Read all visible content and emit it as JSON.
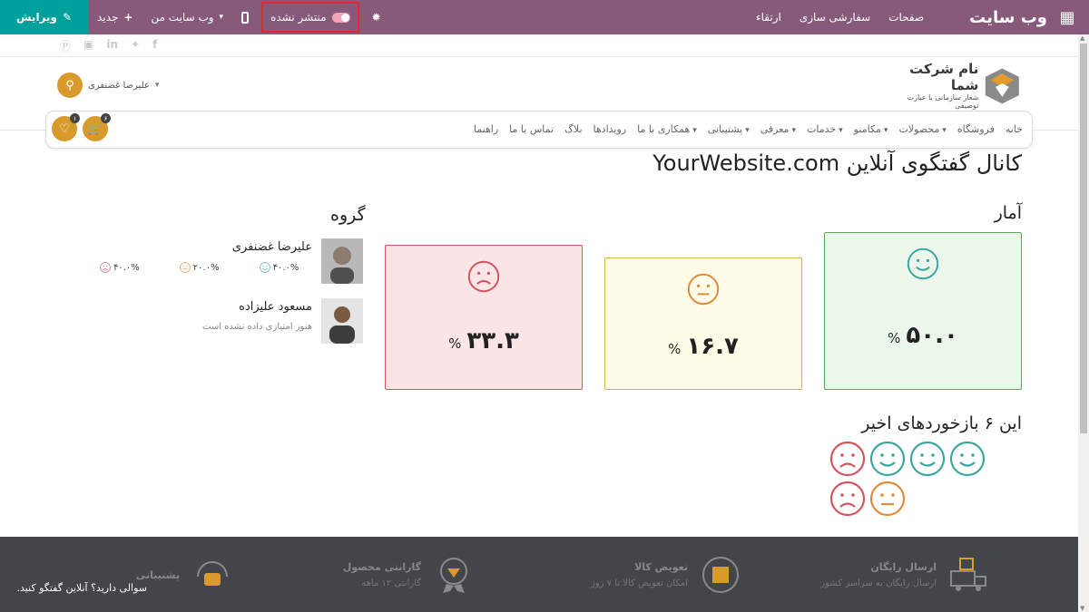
{
  "topbar": {
    "brand": "وب سایت",
    "menu": [
      "صفحات",
      "سفارشی سازی",
      "ارتقاء"
    ],
    "unpublished_label": "منتشر نشده",
    "my_website_label": "وب سایت من",
    "new_label": "جدید",
    "edit_label": "ویرایش"
  },
  "header": {
    "company_name": "نام شرکت شما",
    "company_tagline": "شعار سازمانی یا عبارت توصیفی",
    "user_name": "علیرضا غضنفری",
    "cart_badge": "۶",
    "wishlist_badge": "۱"
  },
  "nav": {
    "items": [
      {
        "label": "خانه",
        "dropdown": false
      },
      {
        "label": "فروشگاه",
        "dropdown": false
      },
      {
        "label": "محصولات",
        "dropdown": true
      },
      {
        "label": "مکامنو",
        "dropdown": true
      },
      {
        "label": "خدمات",
        "dropdown": true
      },
      {
        "label": "معرفی",
        "dropdown": true
      },
      {
        "label": "پشتیبانی",
        "dropdown": true
      },
      {
        "label": "همکاری با ما",
        "dropdown": true
      },
      {
        "label": "رویدادها",
        "dropdown": false
      },
      {
        "label": "بلاگ",
        "dropdown": false
      },
      {
        "label": "تماس با ما",
        "dropdown": false
      },
      {
        "label": "راهنما",
        "dropdown": false
      }
    ]
  },
  "main": {
    "title": "کانال گفتگوی آنلاین YourWebsite.com",
    "stats_title": "آمار",
    "group_title": "گروه",
    "stats": {
      "happy": {
        "value": "۵۰.۰",
        "sign": "%",
        "color": "#5fa85f"
      },
      "neutral": {
        "value": "۱۶.۷",
        "sign": "%",
        "color": "#e08b3a"
      },
      "sad": {
        "value": "۳۳.۳",
        "sign": "%",
        "color": "#d55460"
      }
    },
    "members": [
      {
        "name": "علیرضا غضنفری",
        "happy": "۴۰.۰%",
        "neutral": "۲۰.۰%",
        "sad": "۴۰.۰%"
      },
      {
        "name": "مسعود علیزاده",
        "subtitle": "هنوز امتیازی داده نشده است"
      }
    ],
    "recent_title": "این ۶ بازخوردهای اخیر",
    "recent": [
      "sad",
      "happy",
      "happy",
      "happy",
      "sad",
      "neutral"
    ]
  },
  "footer": {
    "items": [
      {
        "title": "ارسال رایگان",
        "subtitle": "ارسال رایگان به سراسر کشور"
      },
      {
        "title": "تعویض کالا",
        "subtitle": "امکان تعویض کالا تا ۷ روز"
      },
      {
        "title": "گارانتی محصول",
        "subtitle": "گارانتی ۱۲ ماهه"
      },
      {
        "title": "پشتیبانی",
        "subtitle": ""
      }
    ],
    "chat_text": "سوالی دارید؟ آنلاین گفتگو کنید."
  },
  "colors": {
    "topbar": "#875a7b",
    "edit": "#00a09d",
    "accent": "#d89a2b",
    "happy": "#3ba7a0",
    "neutral": "#e08b3a",
    "sad": "#d55460"
  }
}
